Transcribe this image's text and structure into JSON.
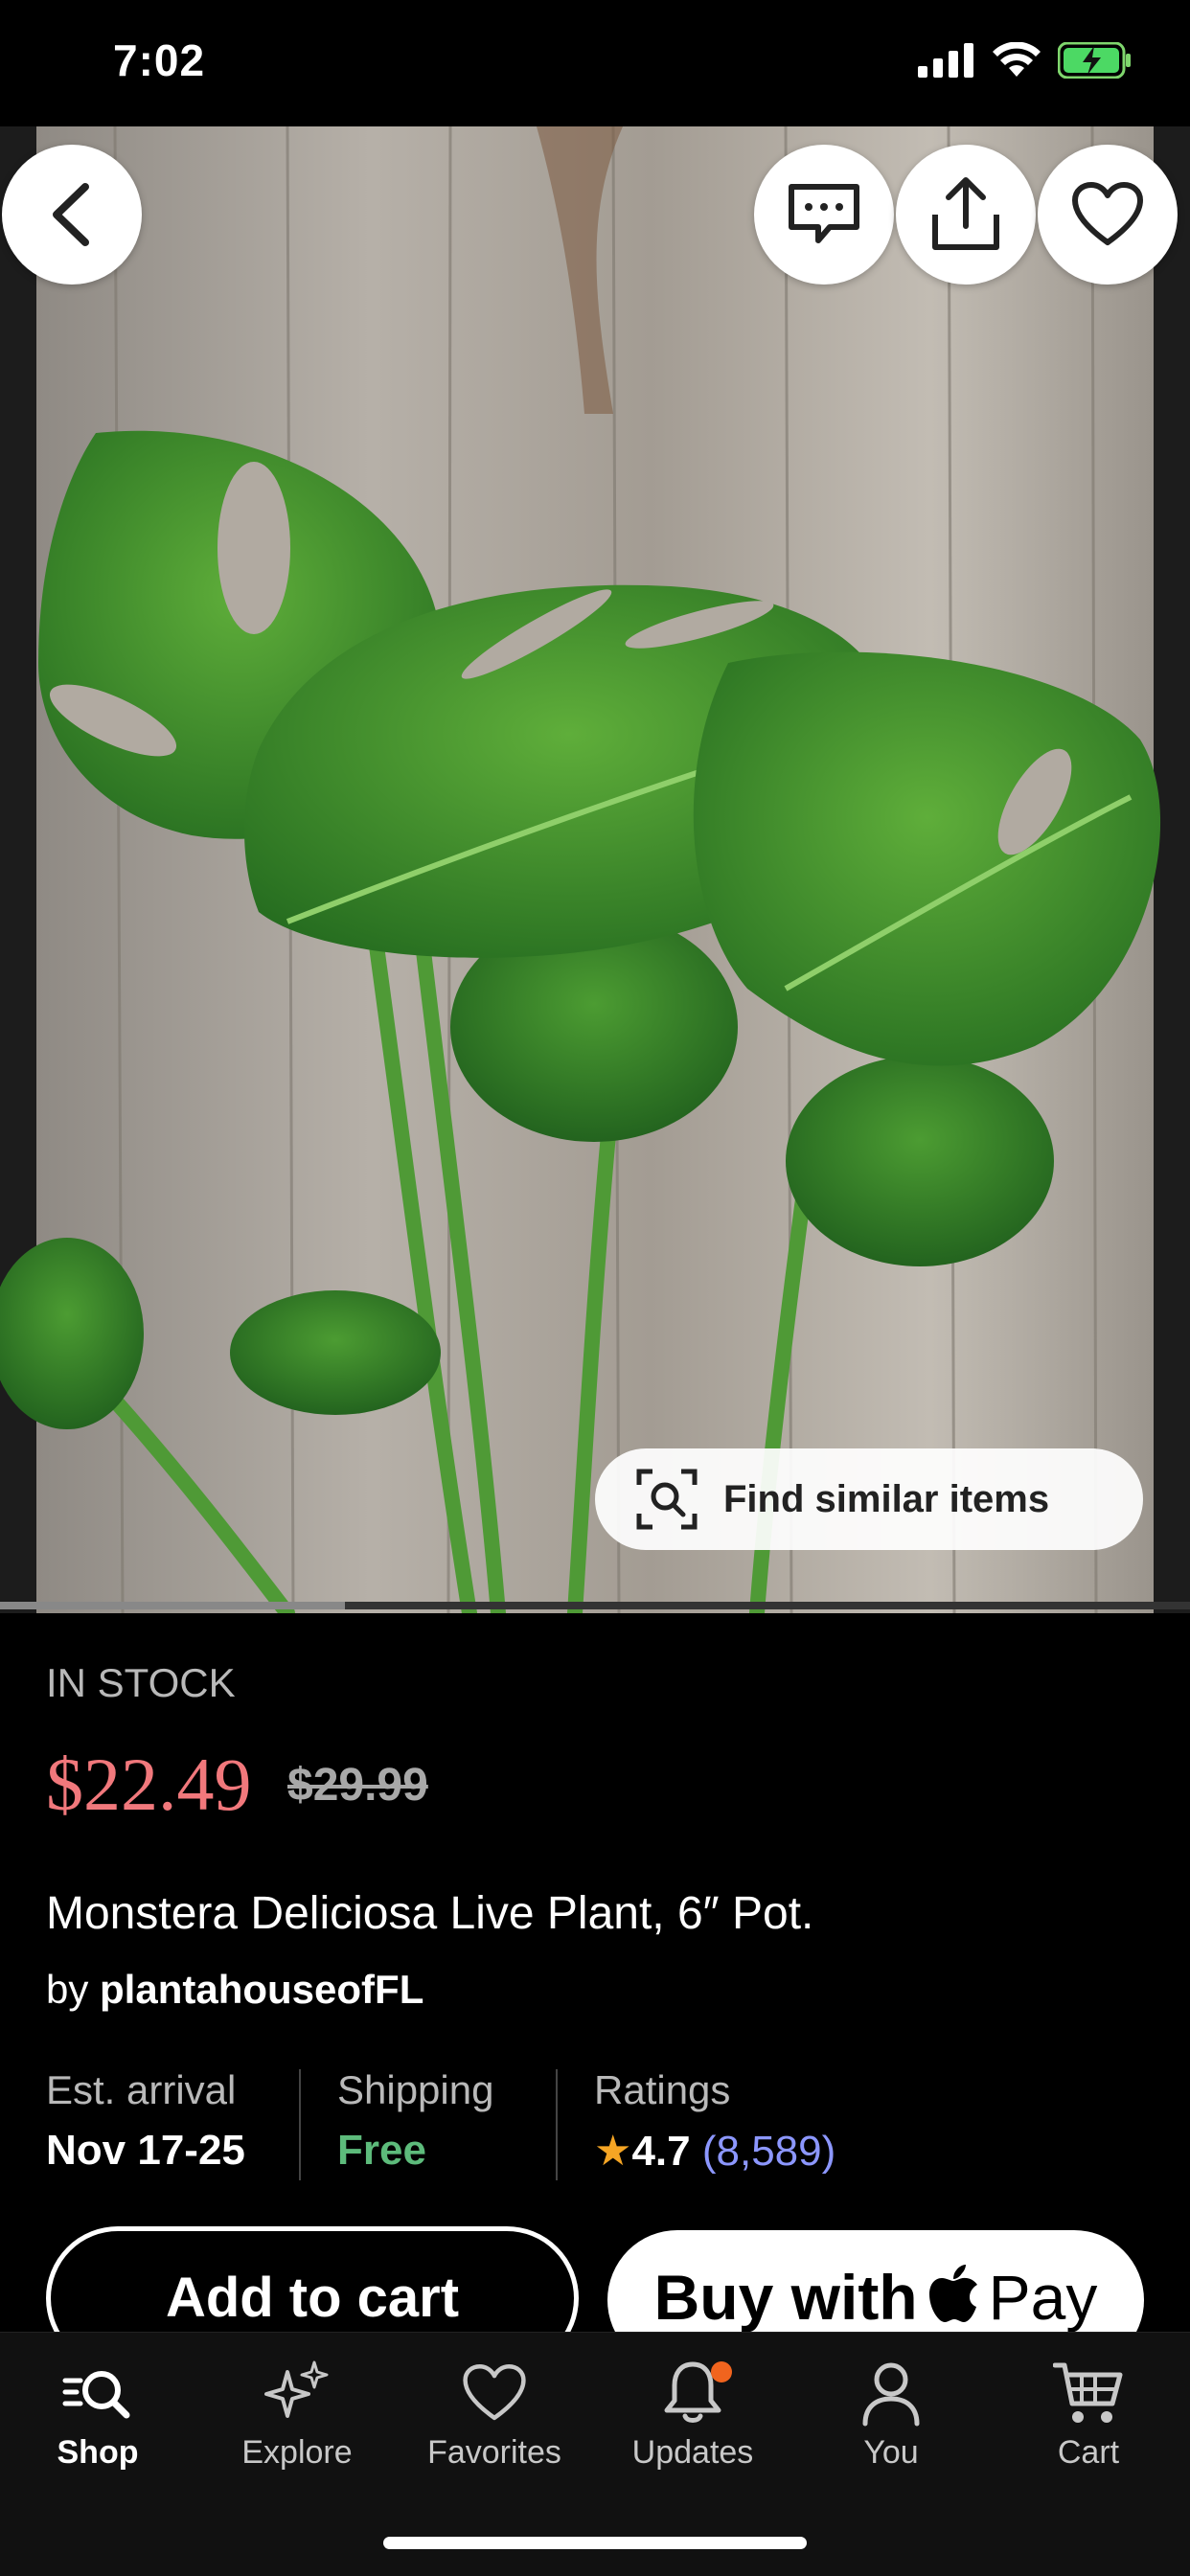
{
  "status_bar": {
    "time": "7:02"
  },
  "product": {
    "stock_label": "IN STOCK",
    "price": "$22.49",
    "original_price": "$29.99",
    "title": "Monstera Deliciosa Live Plant, 6″ Pot.",
    "seller_prefix": "by",
    "seller_name": "plantahouseofFL"
  },
  "image": {
    "find_similar_label": "Find similar items",
    "gallery_progress": 0.29
  },
  "details": {
    "arrival_label": "Est. arrival",
    "arrival_value": "Nov 17-25",
    "shipping_label": "Shipping",
    "shipping_value": "Free",
    "ratings_label": "Ratings",
    "rating_value": "4.7",
    "rating_count": "(8,589)"
  },
  "actions": {
    "add_to_cart": "Add to cart",
    "buy_with": "Buy with",
    "pay": "Pay"
  },
  "tabs": [
    {
      "label": "Shop",
      "icon": "shop-search-icon",
      "active": true
    },
    {
      "label": "Explore",
      "icon": "sparkles-icon"
    },
    {
      "label": "Favorites",
      "icon": "heart-icon"
    },
    {
      "label": "Updates",
      "icon": "bell-icon",
      "badge": true
    },
    {
      "label": "You",
      "icon": "person-icon"
    },
    {
      "label": "Cart",
      "icon": "cart-icon"
    }
  ],
  "colors": {
    "sale_price": "#f1787c",
    "free_shipping": "#5dbb7b",
    "rating_count": "#8c97ff",
    "star": "#f5a524",
    "notification_badge": "#f1641e"
  }
}
